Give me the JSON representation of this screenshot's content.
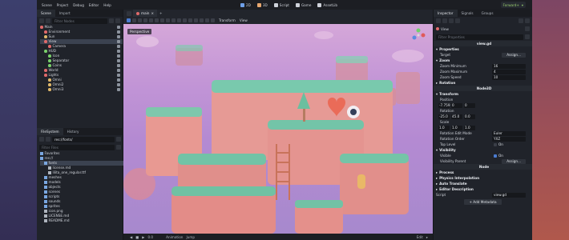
{
  "menu": [
    "Scene",
    "Project",
    "Debug",
    "Editor",
    "Help"
  ],
  "main_screens": [
    {
      "label": "2D",
      "color": "#6fa0e8"
    },
    {
      "label": "3D",
      "color": "#e8a86f"
    },
    {
      "label": "Script",
      "color": "#cfd3da"
    },
    {
      "label": "Game",
      "color": "#cfd3da"
    },
    {
      "label": "AssetLib",
      "color": "#cfd3da"
    }
  ],
  "renderer": "Forward+",
  "scene_dock": {
    "tabs": [
      "Scene",
      "Import"
    ],
    "filter_placeholder": "Filter Nodes",
    "nodes": [
      {
        "label": "Main",
        "depth": 0,
        "color": "#e06a6a",
        "selected": false
      },
      {
        "label": "Environment",
        "depth": 1,
        "color": "#e06a6a",
        "selected": false
      },
      {
        "label": "Sun",
        "depth": 1,
        "color": "#e0b86a",
        "selected": false
      },
      {
        "label": "View",
        "depth": 1,
        "color": "#e06a6a",
        "selected": true
      },
      {
        "label": "Camera",
        "depth": 2,
        "color": "#e06a6a",
        "selected": false
      },
      {
        "label": "HUD",
        "depth": 1,
        "color": "#7ad06a",
        "selected": false
      },
      {
        "label": "Icon",
        "depth": 2,
        "color": "#7ad06a",
        "selected": false
      },
      {
        "label": "Separator",
        "depth": 2,
        "color": "#7ad06a",
        "selected": false
      },
      {
        "label": "Coins",
        "depth": 2,
        "color": "#7ad06a",
        "selected": false
      },
      {
        "label": "World",
        "depth": 1,
        "color": "#e06a6a",
        "selected": false
      },
      {
        "label": "Lights",
        "depth": 1,
        "color": "#e06a6a",
        "selected": false
      },
      {
        "label": "Omni",
        "depth": 2,
        "color": "#e0b86a",
        "selected": false
      },
      {
        "label": "Omni2",
        "depth": 2,
        "color": "#e0b86a",
        "selected": false
      },
      {
        "label": "Omni3",
        "depth": 2,
        "color": "#e0b86a",
        "selected": false
      }
    ]
  },
  "filesystem": {
    "tabs": [
      "FileSystem",
      "History"
    ],
    "path": "res://fonts/",
    "filter_placeholder": "Filter Files",
    "items": [
      {
        "label": "Favorites",
        "depth": 0
      },
      {
        "label": "res://",
        "depth": 0
      },
      {
        "label": "fonts",
        "depth": 1,
        "selected": true
      },
      {
        "label": "license.md",
        "depth": 2
      },
      {
        "label": "lilita_one_regular.ttf",
        "depth": 2
      },
      {
        "label": "meshes",
        "depth": 1
      },
      {
        "label": "models",
        "depth": 1
      },
      {
        "label": "objects",
        "depth": 1
      },
      {
        "label": "scenes",
        "depth": 1
      },
      {
        "label": "scripts",
        "depth": 1
      },
      {
        "label": "sounds",
        "depth": 1
      },
      {
        "label": "sprites",
        "depth": 1
      },
      {
        "label": "icon.png",
        "depth": 1
      },
      {
        "label": "LICENSE.md",
        "depth": 1
      },
      {
        "label": "README.md",
        "depth": 1
      }
    ]
  },
  "viewport": {
    "tab_label": "main",
    "perspective": "Perspective",
    "transform_label": "Transform",
    "view_label": "View"
  },
  "bottom_bar": {
    "time": "0.0",
    "animation": "Animation",
    "jump": "Jump",
    "edit": "Edit"
  },
  "inspector": {
    "tabs": [
      "Inspector",
      "Signals",
      "Groups"
    ],
    "node_name": "View",
    "filter_placeholder": "Filter Properties",
    "script_file": "view.gd",
    "properties_header": "Properties",
    "target_label": "Target",
    "target_button": "Assign...",
    "zoom_header": "Zoom",
    "zoom_minimum_label": "Zoom Minimum",
    "zoom_minimum": "16",
    "zoom_maximum_label": "Zoom Maximum",
    "zoom_maximum": "4",
    "zoom_speed_label": "Zoom Speed",
    "zoom_speed": "10",
    "rotation_header": "Rotation",
    "node3d_header": "Node3D",
    "transform_header": "Transform",
    "position_label": "Position",
    "position": [
      "-7.759",
      "0",
      "0"
    ],
    "rotation_label": "Rotation",
    "rotation": [
      "-25.0",
      "45.0",
      "0.0"
    ],
    "scale_label": "Scale",
    "scale": [
      "1.0",
      "1.0",
      "1.0"
    ],
    "rotation_edit_mode_label": "Rotation Edit Mode",
    "rotation_edit_mode": "Euler",
    "rotation_order_label": "Rotation Order",
    "rotation_order": "YXZ",
    "top_level_label": "Top Level",
    "top_level": "On",
    "visibility_header": "Visibility",
    "visible_label": "Visible",
    "visible": "On",
    "visibility_parent_label": "Visibility Parent",
    "visibility_parent_button": "Assign...",
    "node_header": "Node",
    "process_header": "Process",
    "physics_interpolation_header": "Physics Interpolation",
    "auto_translate_header": "Auto Translate",
    "editor_description_header": "Editor Description",
    "script_label": "Script",
    "add_metadata_button": "Add Metadata"
  }
}
